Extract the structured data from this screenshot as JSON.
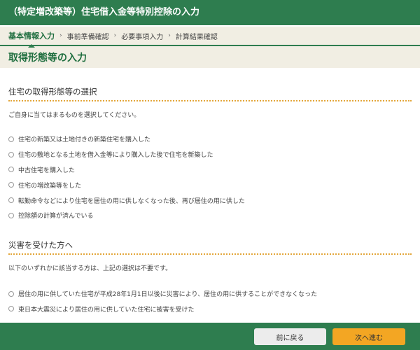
{
  "header": {
    "title": "（特定増改築等）住宅借入金等特別控除の入力"
  },
  "steps": [
    {
      "label": "基本情報入力",
      "active": true
    },
    {
      "label": "事前準備確認",
      "active": false
    },
    {
      "label": "必要事項入力",
      "active": false
    },
    {
      "label": "計算結果確認",
      "active": false
    }
  ],
  "step_separator": "›",
  "page_title": "取得形態等の入力",
  "section1": {
    "title": "住宅の取得形態等の選択",
    "description": "ご自身に当てはまるものを選択してください。",
    "options": [
      "住宅の新築又は土地付きの新築住宅を購入した",
      "住宅の敷地となる土地を借入金等により購入した後で住宅を新築した",
      "中古住宅を購入した",
      "住宅の増改築等をした",
      "転勤命令などにより住宅を居住の用に供しなくなった後、再び居住の用に供した",
      "控除額の計算が済んでいる"
    ]
  },
  "section2": {
    "title": "災害を受けた方へ",
    "description": "以下のいずれかに該当する方は、上記の選択は不要です。",
    "options": [
      "居住の用に供していた住宅が平成28年1月1日以後に災害により、居住の用に供することができなくなった",
      "東日本大震災により居住の用に供していた住宅に被害を受けた"
    ]
  },
  "footer": {
    "back_label": "前に戻る",
    "next_label": "次へ進む"
  },
  "colors": {
    "brand_green": "#2e7d4f",
    "accent_orange": "#f3a623",
    "header_beige": "#f1eee3"
  }
}
